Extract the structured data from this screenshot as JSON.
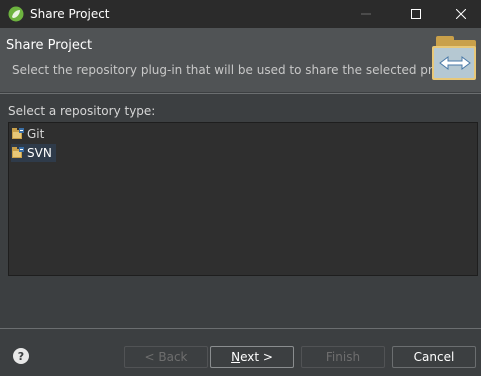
{
  "window": {
    "title": "Share Project",
    "controls": {
      "minimize": "—",
      "maximize": "☐",
      "close": "✕"
    }
  },
  "header": {
    "title": "Share Project",
    "description": "Select the repository plug-in that will be used to share the selected project."
  },
  "repository": {
    "label": "Select a repository type:",
    "items": [
      {
        "label": "Git",
        "selected": false
      },
      {
        "label": "SVN",
        "selected": true
      }
    ]
  },
  "footer": {
    "help": "?",
    "back_label": "< Back",
    "next_label": "Next >",
    "finish_label": "Finish",
    "cancel_label": "Cancel"
  },
  "colors": {
    "background": "#3c3f41",
    "header": "#505355",
    "selection": "#2f3b4a"
  }
}
